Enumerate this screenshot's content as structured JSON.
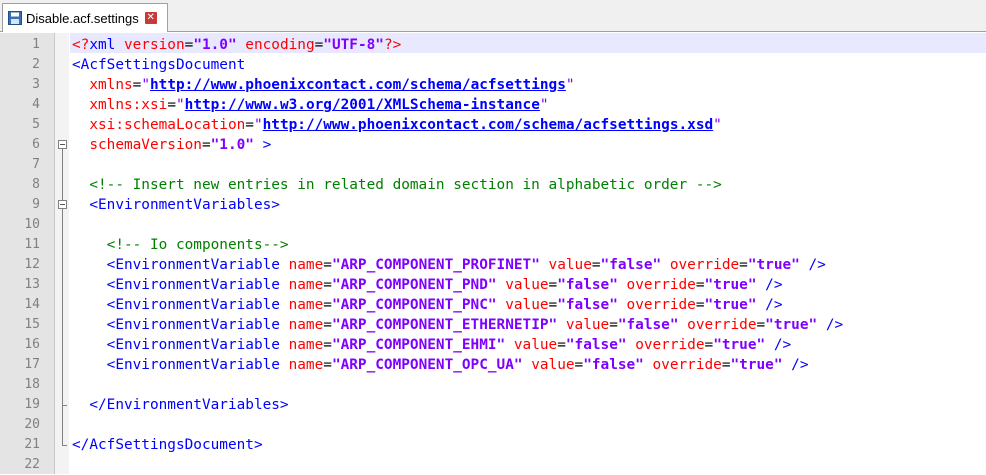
{
  "tab": {
    "title": "Disable.acf.settings",
    "close_glyph": "✕"
  },
  "line_numbers": [
    "1",
    "2",
    "3",
    "4",
    "5",
    "6",
    "7",
    "8",
    "9",
    "10",
    "11",
    "12",
    "13",
    "14",
    "15",
    "16",
    "17",
    "18",
    "19",
    "20",
    "21",
    "22"
  ],
  "lines": [
    [
      {
        "c": "t-pi",
        "t": "<?"
      },
      {
        "c": "t-tag",
        "t": "xml "
      },
      {
        "c": "t-attr",
        "t": "version"
      },
      {
        "c": "t-eq",
        "t": "="
      },
      {
        "c": "t-val",
        "t": "\"1.0\""
      },
      {
        "c": "t-attr",
        "t": " encoding"
      },
      {
        "c": "t-eq",
        "t": "="
      },
      {
        "c": "t-val",
        "t": "\"UTF-8\""
      },
      {
        "c": "t-pi",
        "t": "?>"
      }
    ],
    [
      {
        "c": "t-tag",
        "t": "<AcfSettingsDocument"
      }
    ],
    [
      {
        "c": "t-attr",
        "t": "  xmlns"
      },
      {
        "c": "t-eq",
        "t": "="
      },
      {
        "c": "t-q",
        "t": "\""
      },
      {
        "c": "t-link",
        "t": "http://www.phoenixcontact.com/schema/acfsettings"
      },
      {
        "c": "t-q",
        "t": "\""
      }
    ],
    [
      {
        "c": "t-attr",
        "t": "  xmlns:xsi"
      },
      {
        "c": "t-eq",
        "t": "="
      },
      {
        "c": "t-q",
        "t": "\""
      },
      {
        "c": "t-link",
        "t": "http://www.w3.org/2001/XMLSchema-instance"
      },
      {
        "c": "t-q",
        "t": "\""
      }
    ],
    [
      {
        "c": "t-attr",
        "t": "  xsi:schemaLocation"
      },
      {
        "c": "t-eq",
        "t": "="
      },
      {
        "c": "t-q",
        "t": "\""
      },
      {
        "c": "t-link",
        "t": "http://www.phoenixcontact.com/schema/acfsettings.xsd"
      },
      {
        "c": "t-q",
        "t": "\""
      }
    ],
    [
      {
        "c": "t-attr",
        "t": "  schemaVersion"
      },
      {
        "c": "t-eq",
        "t": "="
      },
      {
        "c": "t-val",
        "t": "\"1.0\""
      },
      {
        "c": "t-tag",
        "t": " >"
      }
    ],
    [],
    [
      {
        "c": "t-comment",
        "t": "  <!-- Insert new entries in related domain section in alphabetic order -->"
      }
    ],
    [
      {
        "c": "t-tag",
        "t": "  <EnvironmentVariables>"
      }
    ],
    [],
    [
      {
        "c": "t-comment",
        "t": "    <!-- Io components-->"
      }
    ],
    [
      {
        "c": "t-tag",
        "t": "    <EnvironmentVariable"
      },
      {
        "c": "t-attr",
        "t": " name"
      },
      {
        "c": "t-eq",
        "t": "="
      },
      {
        "c": "t-val",
        "t": "\"ARP_COMPONENT_PROFINET\""
      },
      {
        "c": "t-attr",
        "t": " value"
      },
      {
        "c": "t-eq",
        "t": "="
      },
      {
        "c": "t-val",
        "t": "\"false\""
      },
      {
        "c": "t-attr",
        "t": " override"
      },
      {
        "c": "t-eq",
        "t": "="
      },
      {
        "c": "t-val",
        "t": "\"true\""
      },
      {
        "c": "t-tag",
        "t": " />"
      }
    ],
    [
      {
        "c": "t-tag",
        "t": "    <EnvironmentVariable"
      },
      {
        "c": "t-attr",
        "t": " name"
      },
      {
        "c": "t-eq",
        "t": "="
      },
      {
        "c": "t-val",
        "t": "\"ARP_COMPONENT_PND\""
      },
      {
        "c": "t-attr",
        "t": " value"
      },
      {
        "c": "t-eq",
        "t": "="
      },
      {
        "c": "t-val",
        "t": "\"false\""
      },
      {
        "c": "t-attr",
        "t": " override"
      },
      {
        "c": "t-eq",
        "t": "="
      },
      {
        "c": "t-val",
        "t": "\"true\""
      },
      {
        "c": "t-tag",
        "t": " />"
      }
    ],
    [
      {
        "c": "t-tag",
        "t": "    <EnvironmentVariable"
      },
      {
        "c": "t-attr",
        "t": " name"
      },
      {
        "c": "t-eq",
        "t": "="
      },
      {
        "c": "t-val",
        "t": "\"ARP_COMPONENT_PNC\""
      },
      {
        "c": "t-attr",
        "t": " value"
      },
      {
        "c": "t-eq",
        "t": "="
      },
      {
        "c": "t-val",
        "t": "\"false\""
      },
      {
        "c": "t-attr",
        "t": " override"
      },
      {
        "c": "t-eq",
        "t": "="
      },
      {
        "c": "t-val",
        "t": "\"true\""
      },
      {
        "c": "t-tag",
        "t": " />"
      }
    ],
    [
      {
        "c": "t-tag",
        "t": "    <EnvironmentVariable"
      },
      {
        "c": "t-attr",
        "t": " name"
      },
      {
        "c": "t-eq",
        "t": "="
      },
      {
        "c": "t-val",
        "t": "\"ARP_COMPONENT_ETHERNETIP\""
      },
      {
        "c": "t-attr",
        "t": " value"
      },
      {
        "c": "t-eq",
        "t": "="
      },
      {
        "c": "t-val",
        "t": "\"false\""
      },
      {
        "c": "t-attr",
        "t": " override"
      },
      {
        "c": "t-eq",
        "t": "="
      },
      {
        "c": "t-val",
        "t": "\"true\""
      },
      {
        "c": "t-tag",
        "t": " />"
      }
    ],
    [
      {
        "c": "t-tag",
        "t": "    <EnvironmentVariable"
      },
      {
        "c": "t-attr",
        "t": " name"
      },
      {
        "c": "t-eq",
        "t": "="
      },
      {
        "c": "t-val",
        "t": "\"ARP_COMPONENT_EHMI\""
      },
      {
        "c": "t-attr",
        "t": " value"
      },
      {
        "c": "t-eq",
        "t": "="
      },
      {
        "c": "t-val",
        "t": "\"false\""
      },
      {
        "c": "t-attr",
        "t": " override"
      },
      {
        "c": "t-eq",
        "t": "="
      },
      {
        "c": "t-val",
        "t": "\"true\""
      },
      {
        "c": "t-tag",
        "t": " />"
      }
    ],
    [
      {
        "c": "t-tag",
        "t": "    <EnvironmentVariable"
      },
      {
        "c": "t-attr",
        "t": " name"
      },
      {
        "c": "t-eq",
        "t": "="
      },
      {
        "c": "t-val",
        "t": "\"ARP_COMPONENT_OPC_UA\""
      },
      {
        "c": "t-attr",
        "t": " value"
      },
      {
        "c": "t-eq",
        "t": "="
      },
      {
        "c": "t-val",
        "t": "\"false\""
      },
      {
        "c": "t-attr",
        "t": " override"
      },
      {
        "c": "t-eq",
        "t": "="
      },
      {
        "c": "t-val",
        "t": "\"true\""
      },
      {
        "c": "t-tag",
        "t": " />"
      }
    ],
    [],
    [
      {
        "c": "t-tag",
        "t": "  </EnvironmentVariables>"
      }
    ],
    [],
    [
      {
        "c": "t-tag",
        "t": "</AcfSettingsDocument>"
      }
    ],
    []
  ],
  "colors": {
    "tag": "#0000ff",
    "attribute": "#ff0000",
    "value": "#8000ff",
    "comment": "#008000",
    "current_line": "#e8e8ff"
  }
}
